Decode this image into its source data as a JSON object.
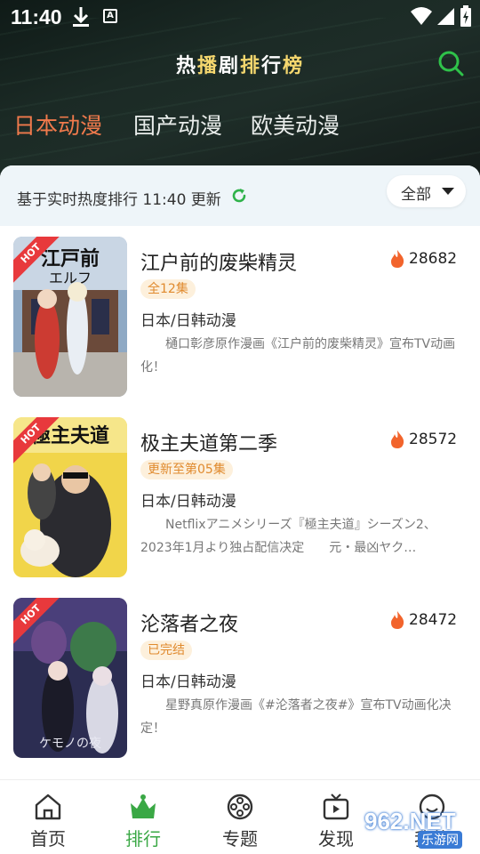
{
  "status_bar": {
    "time": "11:40",
    "a_badge": "A"
  },
  "header": {
    "title_parts": [
      "热",
      "播",
      "剧",
      "排",
      "行",
      "榜"
    ],
    "accent_color": "#f5d76e"
  },
  "category_tabs": [
    {
      "label": "日本动漫",
      "active": true
    },
    {
      "label": "国产动漫",
      "active": false
    },
    {
      "label": "欧美动漫",
      "active": false
    }
  ],
  "update_bar": {
    "text": "基于实时热度排行 11:40 更新",
    "filter_label": "全部"
  },
  "items": [
    {
      "hot_badge": "HOT",
      "title": "江户前的废柴精灵",
      "heat": "28682",
      "episode_tag": "全12集",
      "genre": "日本/日韩动漫",
      "description": "樋口彰彦原作漫画《江户前的废柴精灵》宣布TV动画化！"
    },
    {
      "hot_badge": "HOT",
      "title": "极主夫道第二季",
      "heat": "28572",
      "episode_tag": "更新至第05集",
      "genre": "日本/日韩动漫",
      "description": "Netflixアニメシリーズ『極主夫道』シーズン2、2023年1月より独占配信决定　　元・最凶ヤク…"
    },
    {
      "hot_badge": "HOT",
      "title": "沦落者之夜",
      "heat": "28472",
      "episode_tag": "已完结",
      "genre": "日本/日韩动漫",
      "description": "星野真原作漫画《#沦落者之夜#》宣布TV动画化决定！"
    }
  ],
  "tabbar": [
    {
      "label": "首页",
      "icon": "home-icon",
      "active": false
    },
    {
      "label": "排行",
      "icon": "crown-icon",
      "active": true
    },
    {
      "label": "专题",
      "icon": "film-reel-icon",
      "active": false
    },
    {
      "label": "发现",
      "icon": "tv-icon",
      "active": false
    },
    {
      "label": "我的",
      "icon": "smiley-icon",
      "active": false
    }
  ],
  "watermark": {
    "text": "962.NET",
    "sub": "乐游网"
  },
  "colors": {
    "active_tab": "#f07a4c",
    "active_nav": "#3aa845",
    "hot": "#e8393c",
    "tag_text": "#e08a2e",
    "tag_bg": "#fdf0dc"
  }
}
